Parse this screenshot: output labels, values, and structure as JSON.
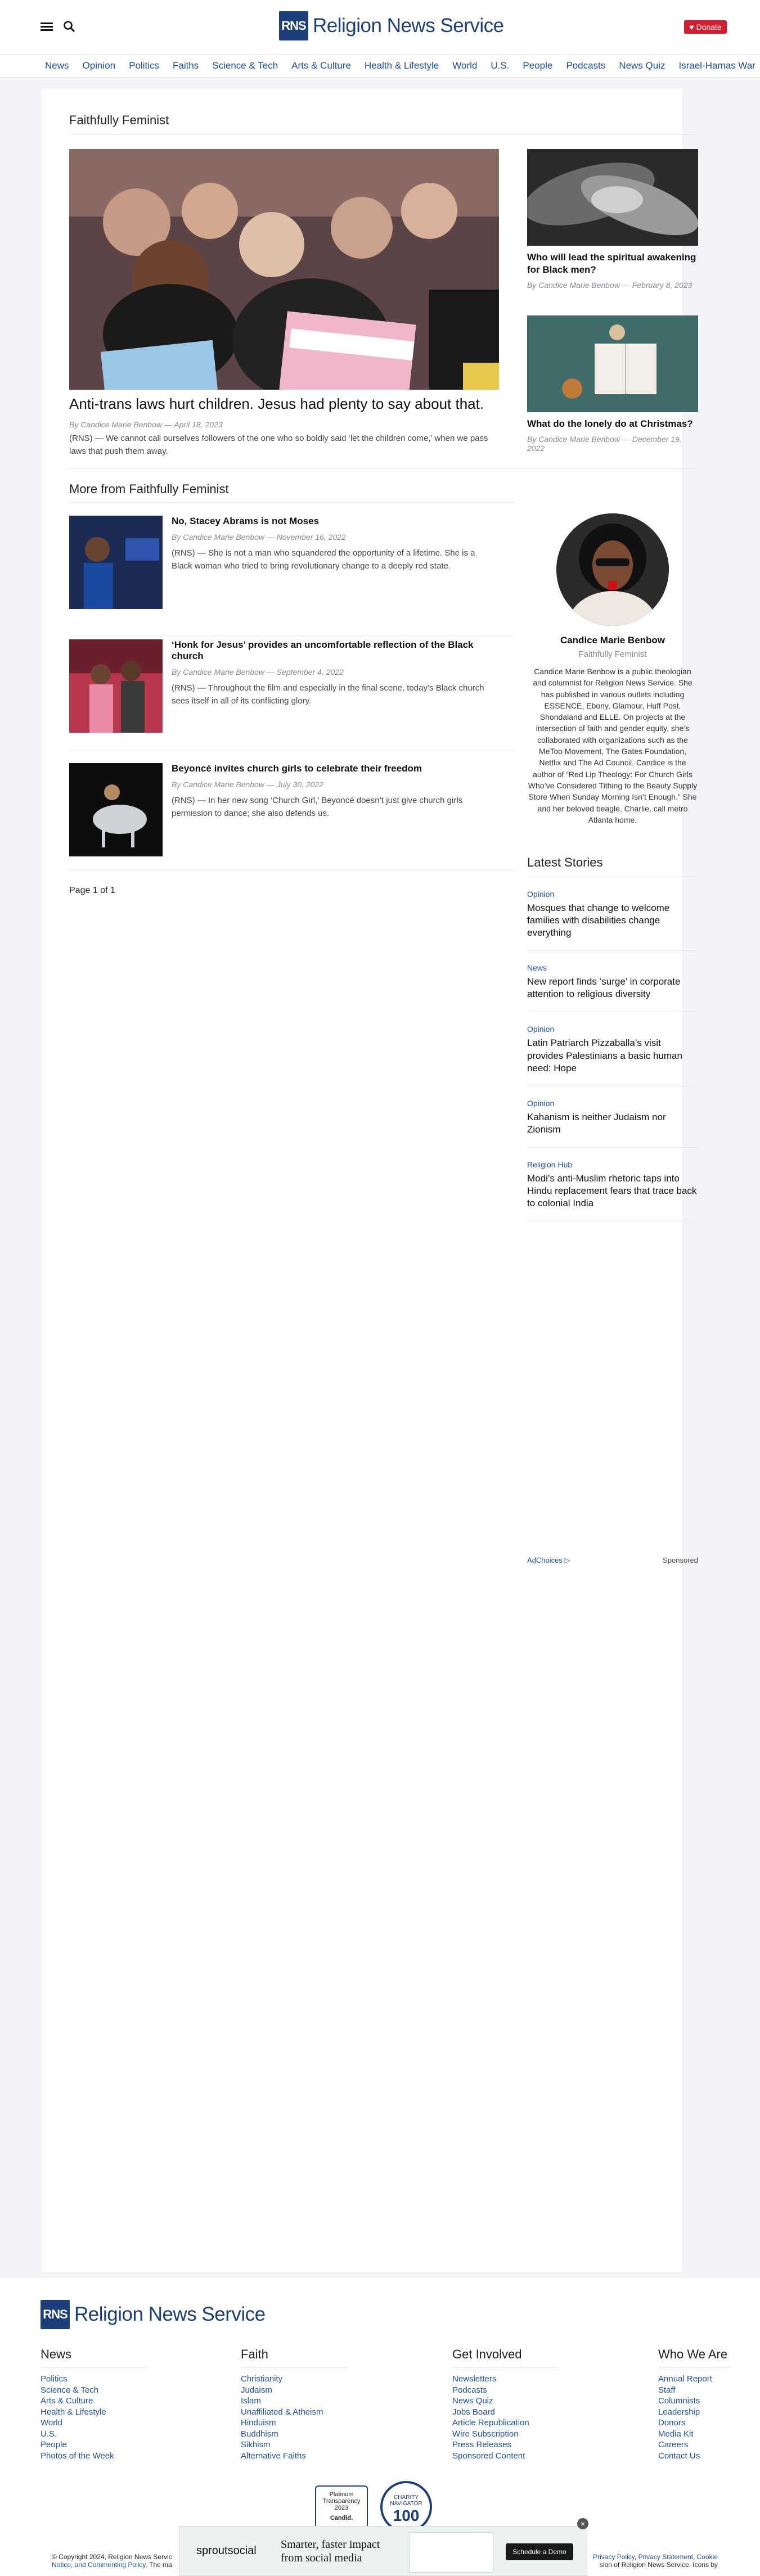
{
  "header": {
    "logo_mark": "RNS",
    "logo_text": "Religion News Service",
    "donate_label": "Donate"
  },
  "nav": [
    "News",
    "Opinion",
    "Politics",
    "Faiths",
    "Science & Tech",
    "Arts & Culture",
    "Health & Lifestyle",
    "World",
    "U.S.",
    "People",
    "Podcasts",
    "News Quiz",
    "Israel-Hamas War"
  ],
  "section_title": "Faithfully Feminist",
  "hero": {
    "title": "Anti-trans laws hurt children. Jesus had plenty to say about that.",
    "meta": "By Candice Marie Benbow — April 18, 2023",
    "excerpt": "(RNS) — We cannot call ourselves followers of the one who so boldly said ‘let the children come,’ when we pass laws that push them away."
  },
  "side_cards": [
    {
      "title": "Who will lead the spiritual awakening for Black men?",
      "meta": "By Candice Marie Benbow — February 8, 2023"
    },
    {
      "title": "What do the lonely do at Christmas?",
      "meta": "By Candice Marie Benbow — December 19, 2022"
    }
  ],
  "more_title": "More from Faithfully Feminist",
  "more_items": [
    {
      "title": "No, Stacey Abrams is not Moses",
      "meta": "By Candice Marie Benbow — November 16, 2022",
      "excerpt": "(RNS) — She is not a man who squandered the opportunity of a lifetime. She is a Black woman who tried to bring revolutionary change to a deeply red state."
    },
    {
      "title": "‘Honk for Jesus’ provides an uncomfortable reflection of the Black church",
      "meta": "By Candice Marie Benbow — September 4, 2022",
      "excerpt": "(RNS) — Throughout the film and especially in the final scene, today’s Black church sees itself in all of its conflicting glory."
    },
    {
      "title": "Beyoncé invites church girls to celebrate their freedom",
      "meta": "By Candice Marie Benbow — July 30, 2022",
      "excerpt": "(RNS) — In her new song ‘Church Girl,’ Beyoncé doesn’t just give church girls permission to dance; she also defends us."
    }
  ],
  "pager": "Page 1 of 1",
  "author": {
    "name": "Candice Marie Benbow",
    "column": "Faithfully Feminist",
    "bio": "Candice Marie Benbow is a public theologian and columnist for Religion News Service. She has published in various outlets including ESSENCE, Ebony, Glamour, Huff Post, Shondaland and ELLE. On projects at the intersection of faith and gender equity, she’s collaborated with organizations such as the MeToo Movement, The Gates Foundation, Netflix and The Ad Council. Candice is the author of “Red Lip Theology: For Church Girls Who’ve Considered Tithing to the Beauty Supply Store When Sunday Morning Isn’t Enough.” She and her beloved beagle, Charlie, call metro Atlanta home."
  },
  "latest": {
    "heading": "Latest Stories",
    "items": [
      {
        "category": "Opinion",
        "title": "Mosques that change to welcome families with disabilities change everything"
      },
      {
        "category": "News",
        "title": "New report finds ‘surge’ in corporate attention to religious diversity"
      },
      {
        "category": "Opinion",
        "title": "Latin Patriarch Pizzaballa’s visit provides Palestinians a basic human need: Hope"
      },
      {
        "category": "Opinion",
        "title": "Kahanism is neither Judaism nor Zionism"
      },
      {
        "category": "Religion Hub",
        "title": "Modi’s anti-Muslim rhetoric taps into Hindu replacement fears that trace back to colonial India"
      }
    ]
  },
  "ad": {
    "choices": "AdChoices",
    "sponsored": "Sponsored"
  },
  "footer": {
    "logo_mark": "RNS",
    "logo_text": "Religion News Service",
    "columns": [
      {
        "heading": "News",
        "links": [
          "Politics",
          "Science & Tech",
          "Arts & Culture",
          "Health & Lifestyle",
          "World",
          "U.S.",
          "People",
          "Photos of the Week"
        ]
      },
      {
        "heading": "Faith",
        "links": [
          "Christianity",
          "Judaism",
          "Islam",
          "Unaffiliated & Atheism",
          "Hinduism",
          "Buddhism",
          "Sikhism",
          "Alternative Faiths"
        ]
      },
      {
        "heading": "Get Involved",
        "links": [
          "Newsletters",
          "Podcasts",
          "News Quiz",
          "Jobs Board",
          "Article Republication",
          "Wire Subscription",
          "Press Releases",
          "Sponsored Content"
        ]
      },
      {
        "heading": "Who We Are",
        "links": [
          "Annual Report",
          "Staff",
          "Columnists",
          "Leadership",
          "Donors",
          "Media Kit",
          "Careers",
          "Contact Us"
        ]
      }
    ],
    "badge1": "Platinum Transparency 2023",
    "badge1_sub": "Candid.",
    "badge2_top": "CHARITY NAVIGATOR",
    "badge2_num": "100",
    "copyright_a": "© Copyright 2024, Religion News Servic",
    "copyright_b": "Notice, and ",
    "commenting": "Commenting Policy",
    "copyright_c": ". The ma",
    "privacy": "Privacy Policy",
    "privacy_stmt": "Privacy Statement",
    "cookie": "Cookie",
    "right_tail": "sion of Religion News Service. Icons by"
  },
  "sticky_ad": {
    "brand": "sproutsocial",
    "tagline": "Smarter, faster impact from social media",
    "cta": "Schedule a Demo"
  }
}
